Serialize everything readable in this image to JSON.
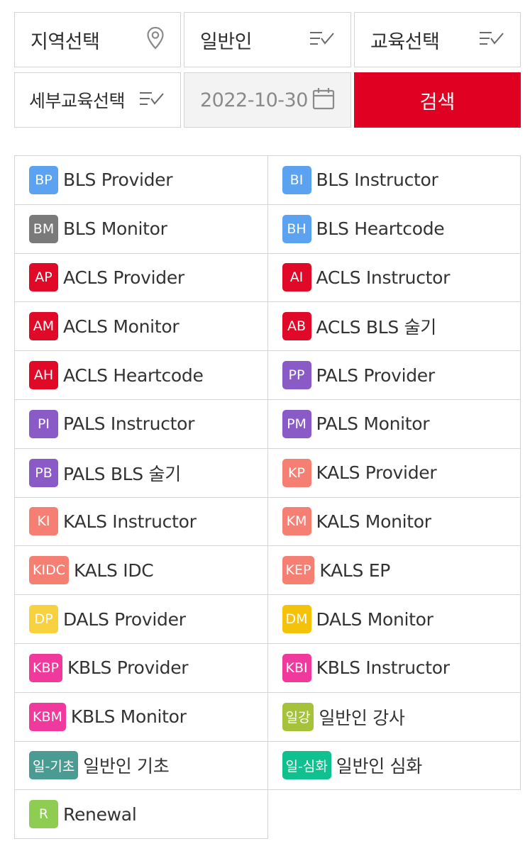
{
  "filters": {
    "region": "지역선택",
    "person_type": "일반인",
    "course": "교육선택",
    "sub_course": "세부교육선택",
    "date": "2022-10-30",
    "search_label": "검색"
  },
  "colors": {
    "accent_red": "#e00022",
    "blue": "#5ba3f0",
    "gray": "#7a7a7a",
    "red": "#e00a28",
    "purple": "#8a5bc6",
    "salmon": "#f67f73",
    "yellow": "#f5c20a",
    "pink": "#f0399c",
    "olive": "#a6c23a",
    "teal": "#4a9c92",
    "green": "#10c08e",
    "lime": "#8fcc52"
  },
  "courses": [
    {
      "code": "BP",
      "name": "BLS Provider",
      "color": "#5ba3f0"
    },
    {
      "code": "BI",
      "name": "BLS Instructor",
      "color": "#5ba3f0"
    },
    {
      "code": "BM",
      "name": "BLS Monitor",
      "color": "#7a7a7a"
    },
    {
      "code": "BH",
      "name": "BLS Heartcode",
      "color": "#5ba3f0"
    },
    {
      "code": "AP",
      "name": "ACLS Provider",
      "color": "#e00a28"
    },
    {
      "code": "AI",
      "name": "ACLS Instructor",
      "color": "#e00a28"
    },
    {
      "code": "AM",
      "name": "ACLS Monitor",
      "color": "#e00a28"
    },
    {
      "code": "AB",
      "name": "ACLS BLS 술기",
      "color": "#e00a28"
    },
    {
      "code": "AH",
      "name": "ACLS Heartcode",
      "color": "#e00a28"
    },
    {
      "code": "PP",
      "name": "PALS Provider",
      "color": "#8a5bc6"
    },
    {
      "code": "PI",
      "name": "PALS Instructor",
      "color": "#8a5bc6"
    },
    {
      "code": "PM",
      "name": "PALS Monitor",
      "color": "#8a5bc6"
    },
    {
      "code": "PB",
      "name": "PALS BLS 술기",
      "color": "#8a5bc6"
    },
    {
      "code": "KP",
      "name": "KALS Provider",
      "color": "#f67f73"
    },
    {
      "code": "KI",
      "name": "KALS Instructor",
      "color": "#f67f73"
    },
    {
      "code": "KM",
      "name": "KALS Monitor",
      "color": "#f67f73"
    },
    {
      "code": "KIDC",
      "name": "KALS IDC",
      "color": "#f67f73"
    },
    {
      "code": "KEP",
      "name": "KALS EP",
      "color": "#f67f73"
    },
    {
      "code": "DP",
      "name": "DALS Provider",
      "color": "#f7d23e"
    },
    {
      "code": "DM",
      "name": "DALS Monitor",
      "color": "#f5c20a"
    },
    {
      "code": "KBP",
      "name": "KBLS Provider",
      "color": "#f0399c"
    },
    {
      "code": "KBI",
      "name": "KBLS Instructor",
      "color": "#f0399c"
    },
    {
      "code": "KBM",
      "name": "KBLS Monitor",
      "color": "#f0399c"
    },
    {
      "code": "일강",
      "name": "일반인 강사",
      "color": "#a6c23a"
    },
    {
      "code": "일-기초",
      "name": "일반인 기초",
      "color": "#4a9c92"
    },
    {
      "code": "일-심화",
      "name": "일반인 심화",
      "color": "#10c08e"
    },
    {
      "code": "R",
      "name": "Renewal",
      "color": "#8fcc52"
    }
  ]
}
